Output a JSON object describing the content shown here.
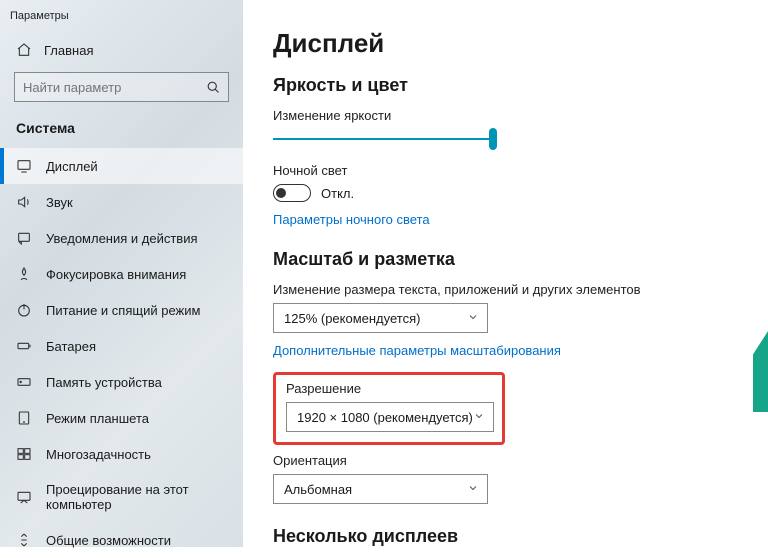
{
  "window_title": "Параметры",
  "home_label": "Главная",
  "search": {
    "placeholder": "Найти параметр"
  },
  "category": "Система",
  "sidebar": {
    "items": [
      {
        "label": "Дисплей"
      },
      {
        "label": "Звук"
      },
      {
        "label": "Уведомления и действия"
      },
      {
        "label": "Фокусировка внимания"
      },
      {
        "label": "Питание и спящий режим"
      },
      {
        "label": "Батарея"
      },
      {
        "label": "Память устройства"
      },
      {
        "label": "Режим планшета"
      },
      {
        "label": "Многозадачность"
      },
      {
        "label": "Проецирование на этот компьютер"
      },
      {
        "label": "Общие возможности"
      }
    ]
  },
  "page": {
    "title": "Дисплей",
    "brightness_section": "Яркость и цвет",
    "brightness_label": "Изменение яркости",
    "nightlight_label": "Ночной свет",
    "nightlight_state": "Откл.",
    "nightlight_link": "Параметры ночного света",
    "scale_section": "Масштаб и разметка",
    "scale_label": "Изменение размера текста, приложений и других элементов",
    "scale_value": "125% (рекомендуется)",
    "scale_link": "Дополнительные параметры масштабирования",
    "resolution_label": "Разрешение",
    "resolution_value": "1920 × 1080 (рекомендуется)",
    "orientation_label": "Ориентация",
    "orientation_value": "Альбомная",
    "multi_section": "Несколько дисплеев"
  }
}
